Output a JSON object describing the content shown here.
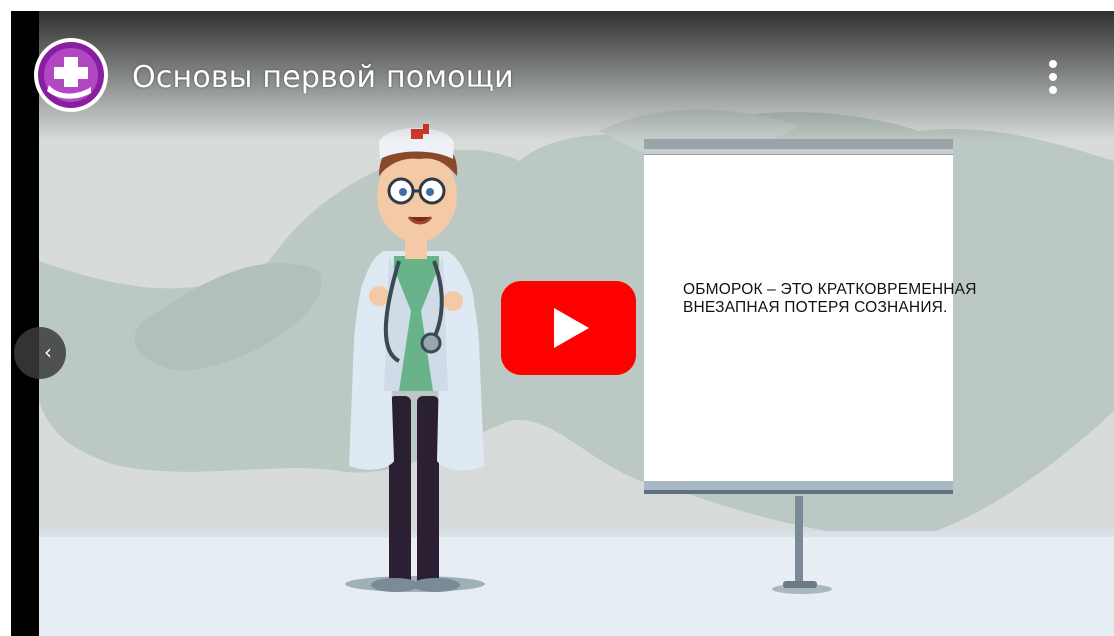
{
  "player": {
    "title": "Основы первой помощи",
    "channel_logo_icon": "first-aid-cross-hand-logo",
    "more_icon": "vertical-dots-icon",
    "prev_icon": "chevron-left-icon",
    "prev_glyph": "‹",
    "play_icon": "youtube-play-icon"
  },
  "slide": {
    "board_text": "ОБМОРОК – ЭТО КРАТКОВРЕМЕННАЯ ВНЕЗАПНАЯ ПОТЕРЯ СОЗНАНИЯ."
  },
  "colors": {
    "play_red": "#ff0000",
    "logo_purple": "#8a1ea0",
    "scene_background": "#d7dcdb",
    "floor": "#e6eef4"
  }
}
